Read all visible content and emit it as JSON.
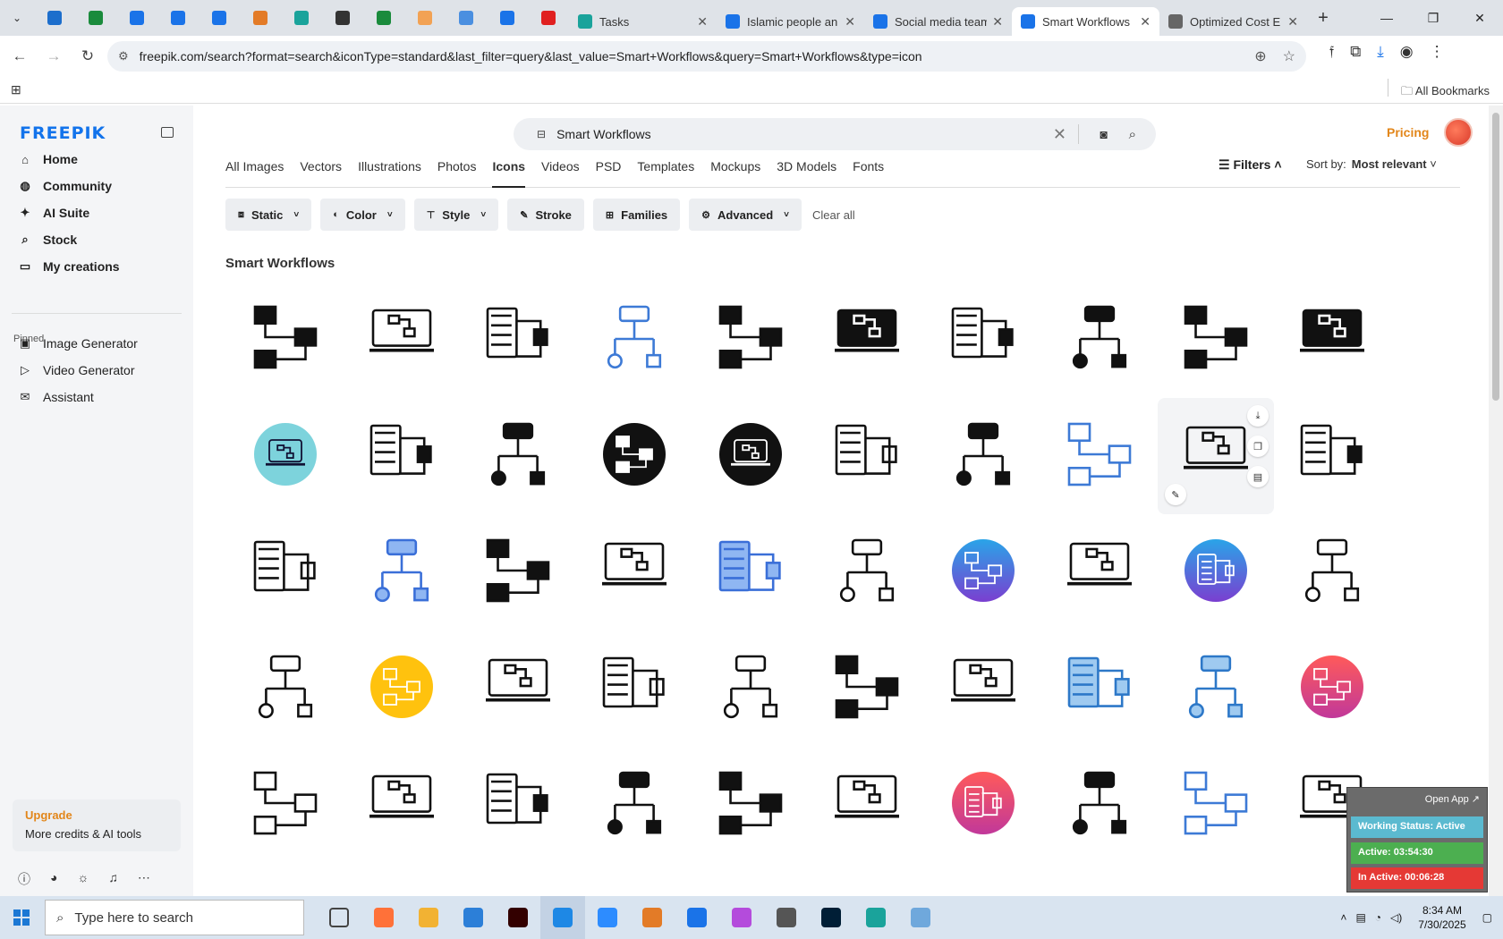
{
  "browser": {
    "tabs": [
      {
        "title": "Tasks",
        "color": "#1aa39b"
      },
      {
        "title": "Islamic people an",
        "color": "#1a73e8"
      },
      {
        "title": "Social media team",
        "color": "#1a73e8"
      },
      {
        "title": "Smart Workflows",
        "color": "#1a73e8",
        "active": true
      },
      {
        "title": "Optimized Cost E",
        "color": "#666666"
      }
    ],
    "pinned_tab_colors": [
      "#1c6ecc",
      "#1a8b3c",
      "#1a73e8",
      "#1a73e8",
      "#1a73e8",
      "#e37b27",
      "#1aa39b",
      "#333333",
      "#1a8b3c",
      "#f2a254",
      "#4a8fe0",
      "#1a73e8",
      "#e02020"
    ],
    "url": "freepik.com/search?format=search&iconType=standard&last_filter=query&last_value=Smart+Workflows&query=Smart+Workflows&type=icon",
    "bookmarks_label": "All Bookmarks"
  },
  "sidebar": {
    "logo": "FREEPIK",
    "items": [
      {
        "label": "Home",
        "icon": "home-icon",
        "glyph": "⌂"
      },
      {
        "label": "Community",
        "icon": "globe-icon",
        "glyph": "◍"
      },
      {
        "label": "AI Suite",
        "icon": "sparkle-icon",
        "glyph": "✦"
      },
      {
        "label": "Stock",
        "icon": "search-icon",
        "glyph": "⌕"
      },
      {
        "label": "My creations",
        "icon": "folder-icon",
        "glyph": "▭"
      }
    ],
    "pinned_label": "Pinned",
    "pinned": [
      {
        "label": "Image Generator",
        "icon": "image-icon",
        "glyph": "▣"
      },
      {
        "label": "Video Generator",
        "icon": "video-icon",
        "glyph": "▷"
      },
      {
        "label": "Assistant",
        "icon": "chat-icon",
        "glyph": "✉"
      }
    ],
    "upgrade": {
      "title": "Upgrade",
      "subtitle": "More credits & AI tools"
    }
  },
  "search": {
    "query": "Smart Workflows"
  },
  "header": {
    "pricing": "Pricing"
  },
  "type_tabs": [
    "All Images",
    "Vectors",
    "Illustrations",
    "Photos",
    "Icons",
    "Videos",
    "PSD",
    "Templates",
    "Mockups",
    "3D Models",
    "Fonts"
  ],
  "active_type_tab": "Icons",
  "filters_label": "Filters",
  "sort": {
    "label": "Sort by:",
    "value": "Most relevant"
  },
  "chips": [
    {
      "label": "Static",
      "icon": "motion-icon",
      "dropdown": true
    },
    {
      "label": "Color",
      "icon": "palette-icon",
      "dropdown": true
    },
    {
      "label": "Style",
      "icon": "brush-icon",
      "dropdown": true
    },
    {
      "label": "Stroke",
      "icon": "pen-icon",
      "dropdown": false
    },
    {
      "label": "Families",
      "icon": "grid-icon",
      "dropdown": false
    },
    {
      "label": "Advanced",
      "icon": "gear-icon",
      "dropdown": true
    }
  ],
  "clear_all": "Clear all",
  "section_title": "Smart Workflows",
  "results_grid": {
    "columns": 10,
    "hovered_index": 18,
    "icons": [
      {
        "name": "workflow-arrows-icon",
        "style": "black"
      },
      {
        "name": "database-workflow-icon",
        "style": "outline"
      },
      {
        "name": "flowchart-shapes-icon",
        "style": "black"
      },
      {
        "name": "workflow-hub-icon",
        "style": "blue-outline"
      },
      {
        "name": "flowchart-loop-icon",
        "style": "black"
      },
      {
        "name": "monitor-workflow-icon",
        "style": "black"
      },
      {
        "name": "workflow-path-icon",
        "style": "black"
      },
      {
        "name": "mobile-workflow-icon",
        "style": "black"
      },
      {
        "name": "document-workflow-icon",
        "style": "black"
      },
      {
        "name": "laptop-flowchart-icon",
        "style": "black"
      },
      {
        "name": "teal-circle-workflow-icon",
        "style": "teal-circle"
      },
      {
        "name": "document-workflow-icon",
        "style": "black"
      },
      {
        "name": "hierarchy-flowchart-icon",
        "style": "black"
      },
      {
        "name": "circle-document-workflow-icon",
        "style": "black-circle"
      },
      {
        "name": "circle-document-workflow-icon",
        "style": "black-circle"
      },
      {
        "name": "flowchart-shapes-icon",
        "style": "outline"
      },
      {
        "name": "workflow-cycle-icon",
        "style": "black"
      },
      {
        "name": "document-workflow-icon",
        "style": "blue-outline"
      },
      {
        "name": "document-workflow-icon",
        "style": "outline"
      },
      {
        "name": "folder-workflow-icon",
        "style": "black"
      },
      {
        "name": "laptop-flowchart-icon",
        "style": "outline"
      },
      {
        "name": "document-workflow-icon",
        "style": "blue-gradient"
      },
      {
        "name": "folder-flow-icon",
        "style": "black"
      },
      {
        "name": "monitor-workflow-icon",
        "style": "outline"
      },
      {
        "name": "document-workflow-icon",
        "style": "blue-gradient"
      },
      {
        "name": "process-map-icon",
        "style": "outline"
      },
      {
        "name": "circle-document-workflow-icon",
        "style": "purple-circle"
      },
      {
        "name": "laptop-flowchart-icon",
        "style": "outline"
      },
      {
        "name": "circle-document-workflow-icon",
        "style": "purple-circle"
      },
      {
        "name": "mobile-workflow-icon",
        "style": "outline"
      },
      {
        "name": "mobile-workflow-icon",
        "style": "outline"
      },
      {
        "name": "yellow-circle-network-icon",
        "style": "yellow-circle"
      },
      {
        "name": "flowchart-check-icon",
        "style": "outline"
      },
      {
        "name": "gear-workflow-icon",
        "style": "outline"
      },
      {
        "name": "idea-flowchart-icon",
        "style": "outline"
      },
      {
        "name": "flowchart-loop-icon",
        "style": "black"
      },
      {
        "name": "layered-workflow-icon",
        "style": "outline"
      },
      {
        "name": "blue-flow-blocks-icon",
        "style": "blue-flat"
      },
      {
        "name": "blue-flow-blocks-icon",
        "style": "blue-flat"
      },
      {
        "name": "gear-circle-workflow-icon",
        "style": "pink-circle"
      },
      {
        "name": "flowchart-loop-icon",
        "style": "outline"
      },
      {
        "name": "gear-document-workflow-icon",
        "style": "outline"
      },
      {
        "name": "hierarchy-flowchart-icon",
        "style": "black"
      },
      {
        "name": "branch-flowchart-icon",
        "style": "black"
      },
      {
        "name": "gear-network-icon",
        "style": "black"
      },
      {
        "name": "monitor-workflow-icon",
        "style": "outline"
      },
      {
        "name": "pink-circle-network-icon",
        "style": "pink-circle"
      },
      {
        "name": "flowchart-loop-icon",
        "style": "black"
      },
      {
        "name": "workflow-lists-icon",
        "style": "blue-outline"
      },
      {
        "name": "workflow-icon",
        "style": "outline"
      }
    ]
  },
  "tracker": {
    "open_app": "Open App ↗",
    "status": "Working Status: Active",
    "active": "Active: 03:54:30",
    "inactive": "In Active: 00:06:28",
    "colors": {
      "status": "#5bbad0",
      "active": "#4caf50",
      "inactive": "#e53935"
    }
  },
  "taskbar": {
    "search_placeholder": "Type here to search",
    "app_colors": [
      "#444444",
      "#ff7139",
      "#f2b233",
      "#2c7fd8",
      "#330000",
      "#1e88e5",
      "#2d8cff",
      "#e37b27",
      "#1a73e8",
      "#b44bdc",
      "#555555",
      "#001e36",
      "#1aa39b",
      "#6fa8dc"
    ],
    "time": "8:34 AM",
    "date": "7/30/2025"
  },
  "colors": {
    "brand": "#1273eb",
    "accent": "#e2861a"
  }
}
